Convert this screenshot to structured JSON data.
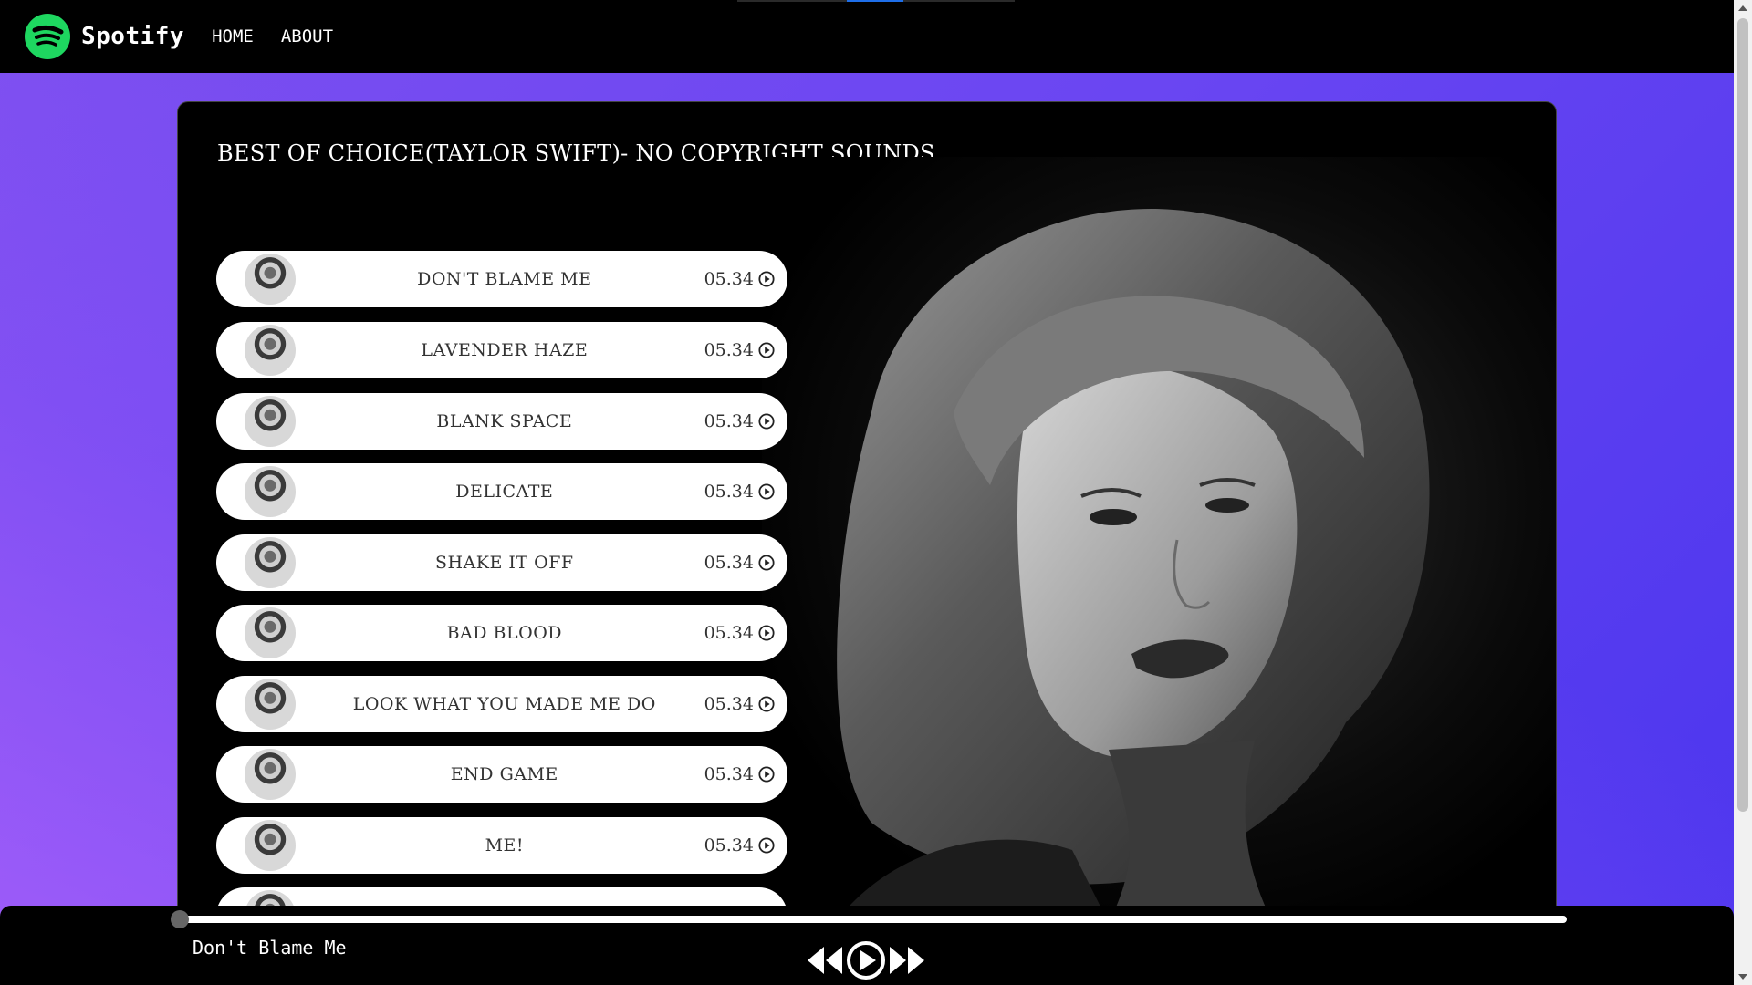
{
  "nav": {
    "brand": "Spotify",
    "links": [
      "HOME",
      "ABOUT"
    ]
  },
  "card": {
    "title": "BEST OF CHOICE(TAYLOR SWIFT)- NO COPYRIGHT SOUNDS"
  },
  "songs": [
    {
      "name": "DON'T BLAME ME",
      "time": "05.34"
    },
    {
      "name": "LAVENDER HAZE",
      "time": "05.34"
    },
    {
      "name": "BLANK SPACE",
      "time": "05.34"
    },
    {
      "name": "DELICATE",
      "time": "05.34"
    },
    {
      "name": "SHAKE IT OFF",
      "time": "05.34"
    },
    {
      "name": "BAD BLOOD",
      "time": "05.34"
    },
    {
      "name": "LOOK WHAT YOU MADE ME DO",
      "time": "05.34"
    },
    {
      "name": "END GAME",
      "time": "05.34"
    },
    {
      "name": "ME!",
      "time": "05.34"
    },
    {
      "name": "",
      "time": ""
    }
  ],
  "player": {
    "now_playing": "Don't Blame Me",
    "progress": 0
  },
  "colors": {
    "accent": "#1ed760",
    "background_gradient_start": "#7d4ff0",
    "background_gradient_end": "#4a35ee"
  },
  "icons": {
    "logo": "spotify-logo-icon",
    "song_play": "play-circle-icon",
    "prev": "rewind-icon",
    "play": "play-circle-icon",
    "next": "fast-forward-icon"
  }
}
